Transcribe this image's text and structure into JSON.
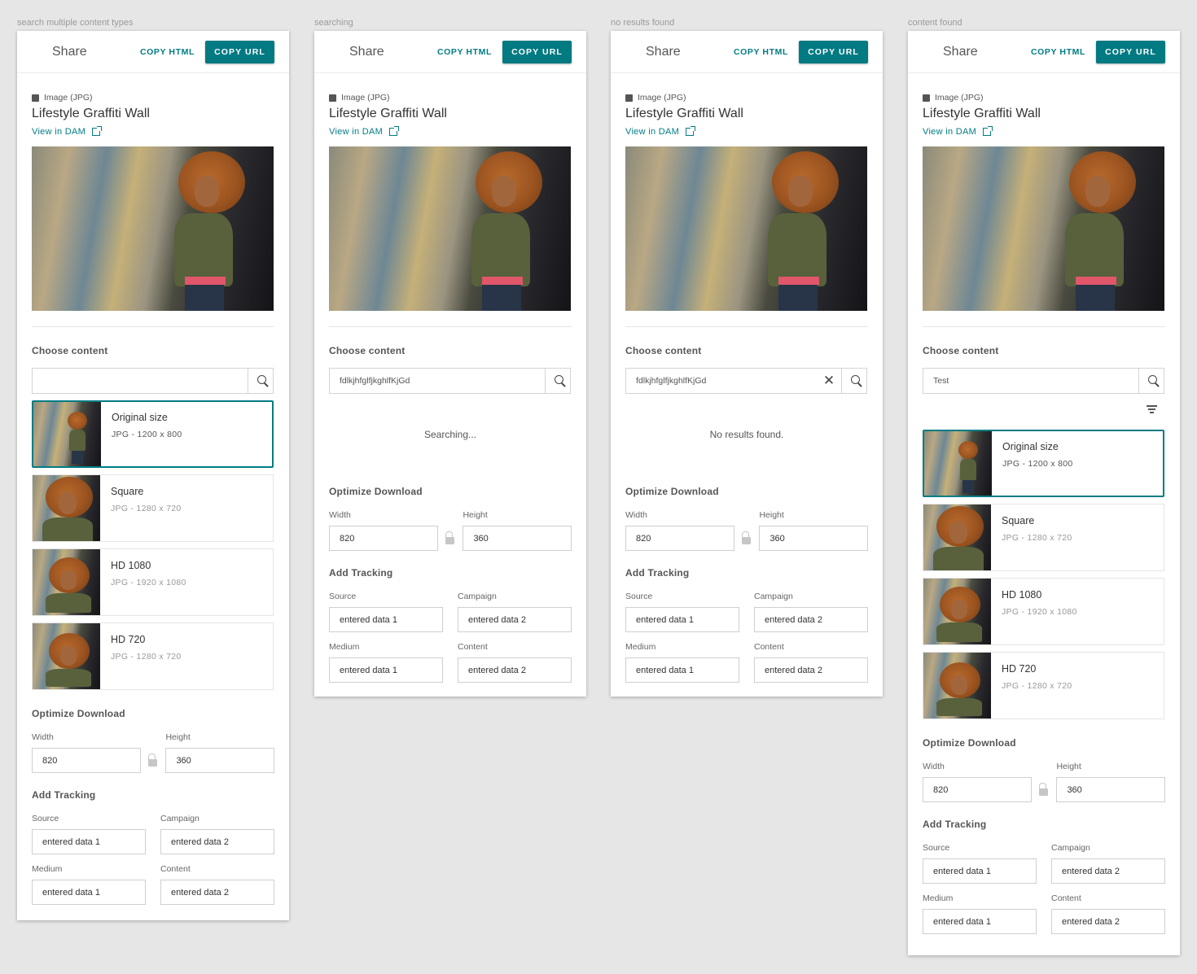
{
  "common": {
    "share_title": "Share",
    "copy_html": "COPY HTML",
    "copy_url": "COPY URL",
    "asset_type": "Image (JPG)",
    "asset_title": "Lifestyle Graffiti Wall",
    "view_in_dam": "View in DAM",
    "choose_content": "Choose content",
    "optimize_download": "Optimize Download",
    "width_label": "Width",
    "height_label": "Height",
    "width_value": "820",
    "height_value": "360",
    "add_tracking": "Add Tracking",
    "source_label": "Source",
    "campaign_label": "Campaign",
    "medium_label": "Medium",
    "content_label": "Content",
    "source_value": "entered data 1",
    "campaign_value": "entered data 2",
    "medium_value": "entered data 1",
    "content_value": "entered data 2"
  },
  "renditions": [
    {
      "name": "Original size",
      "meta": "JPG - 1200 x 800"
    },
    {
      "name": "Square",
      "meta": "JPG - 1280 x 720"
    },
    {
      "name": "HD 1080",
      "meta": "JPG - 1920 x 1080"
    },
    {
      "name": "HD 720",
      "meta": "JPG - 1280 x 720"
    }
  ],
  "panels": [
    {
      "label": "search multiple content types",
      "search_value": "",
      "status": ""
    },
    {
      "label": "searching",
      "search_value": "fdlkjhfglfjkghlfKjGd",
      "status": "Searching..."
    },
    {
      "label": "no results found",
      "search_value": "fdlkjhfglfjkghlfKjGd",
      "status": "No results found."
    },
    {
      "label": "content found",
      "search_value": "Test",
      "status": ""
    }
  ],
  "colors": {
    "accent": "#017c84",
    "primary_button": "#017a82",
    "background": "#e6e6e6"
  },
  "icons": [
    "image-icon",
    "external-link-icon",
    "search-icon",
    "close-icon",
    "filter-icon",
    "lock-icon"
  ]
}
